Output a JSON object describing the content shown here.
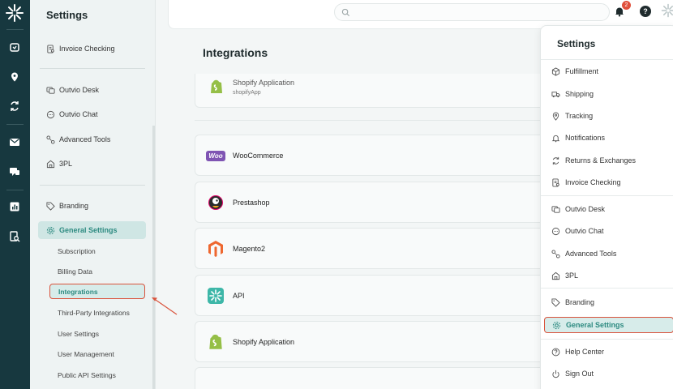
{
  "sidebar": {
    "title": "Settings",
    "items": [
      {
        "label": "Invoice Checking",
        "icon": "invoice-icon"
      },
      {
        "label": "Outvio Desk",
        "icon": "desk-icon"
      },
      {
        "label": "Outvio Chat",
        "icon": "chat-icon"
      },
      {
        "label": "Advanced Tools",
        "icon": "tools-icon"
      },
      {
        "label": "3PL",
        "icon": "warehouse-icon"
      },
      {
        "label": "Branding",
        "icon": "tag-icon"
      },
      {
        "label": "General Settings",
        "icon": "gear-icon"
      }
    ],
    "subitems": [
      "Subscription",
      "Billing Data",
      "Integrations",
      "Third-Party Integrations",
      "User Settings",
      "User Management",
      "Public API Settings"
    ]
  },
  "topbar": {
    "search_placeholder": "",
    "notification_count": "2",
    "help_label": "?"
  },
  "main": {
    "title": "Integrations",
    "top_card": {
      "name": "Shopify Application",
      "sub": "shopifyApp"
    },
    "cards": [
      {
        "name": "WooCommerce"
      },
      {
        "name": "Prestashop"
      },
      {
        "name": "Magento2"
      },
      {
        "name": "API"
      },
      {
        "name": "Shopify Application"
      }
    ],
    "woo_logo_text": "Woo"
  },
  "dropdown": {
    "title": "Settings",
    "items": [
      "Fulfillment",
      "Shipping",
      "Tracking",
      "Notifications",
      "Returns & Exchanges",
      "Invoice Checking",
      "Outvio Desk",
      "Outvio Chat",
      "Advanced Tools",
      "3PL",
      "Branding",
      "General Settings",
      "Help Center",
      "Sign Out"
    ]
  },
  "colors": {
    "rail": "#17383f",
    "accent": "#2c8a80",
    "highlight": "#d9533c"
  }
}
